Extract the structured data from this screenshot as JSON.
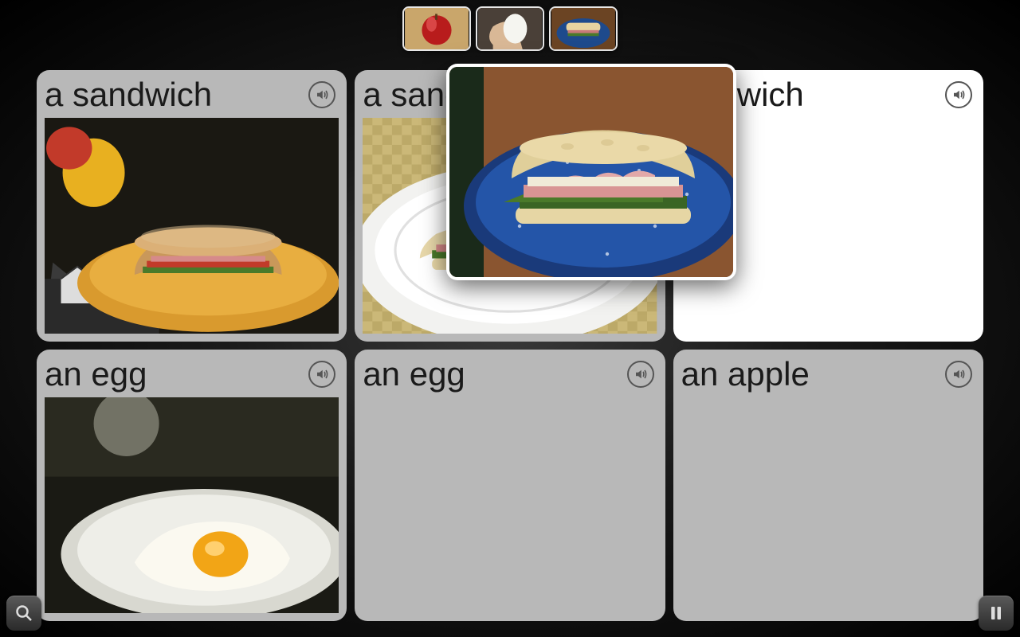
{
  "thumbs": [
    {
      "name": "apple"
    },
    {
      "name": "egg"
    },
    {
      "name": "sandwich"
    }
  ],
  "cards": [
    {
      "label": "a sandwich",
      "has_image": true,
      "image": "sandwich-yellow-plate",
      "bg": "filled"
    },
    {
      "label": "a sandwich",
      "has_image": true,
      "image": "sandwich-white-plate",
      "bg": "filled"
    },
    {
      "label": "andwich",
      "has_image": false,
      "image": "",
      "bg": "empty"
    },
    {
      "label": "an egg",
      "has_image": true,
      "image": "fried-egg",
      "bg": "filled"
    },
    {
      "label": "an egg",
      "has_image": false,
      "image": "",
      "bg": "filled"
    },
    {
      "label": "an apple",
      "has_image": false,
      "image": "",
      "bg": "filled"
    }
  ],
  "popup": {
    "image": "sandwich-blue-plate"
  }
}
